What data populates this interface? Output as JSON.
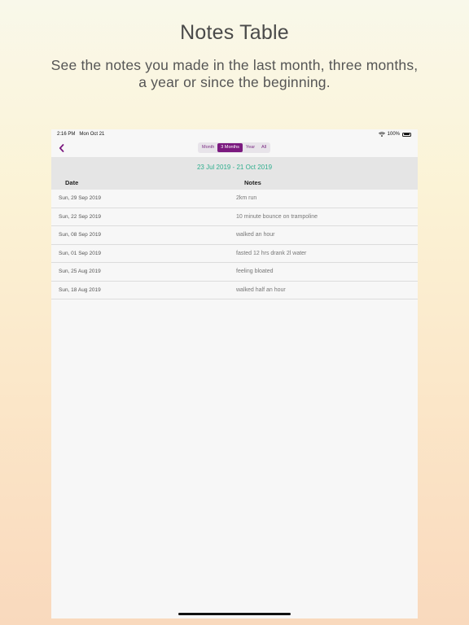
{
  "promo": {
    "title": "Notes Table",
    "subtitle": "See the notes you made in the last month, three months, a year or since the beginning."
  },
  "status_bar": {
    "time": "2:16 PM",
    "date": "Mon Oct 21",
    "battery": "100%",
    "icons": [
      "wifi-icon",
      "battery-icon"
    ]
  },
  "nav": {
    "back_icon": "chevron-left-icon",
    "segments": [
      "Month",
      "3 Months",
      "Year",
      "All"
    ],
    "selected_segment": "3 Months"
  },
  "table": {
    "date_range": "23 Jul 2019 - 21 Oct 2019",
    "columns": [
      "Date",
      "Notes"
    ],
    "rows": [
      {
        "date": "Sun, 29 Sep 2019",
        "note": "2km run"
      },
      {
        "date": "Sun, 22 Sep 2019",
        "note": "10 minute bounce on trampoline"
      },
      {
        "date": "Sun, 08 Sep 2019",
        "note": "walked an hour"
      },
      {
        "date": "Sun, 01 Sep 2019",
        "note": "fasted 12 hrs drank 2l water"
      },
      {
        "date": "Sun, 25 Aug 2019",
        "note": "feeling bloated"
      },
      {
        "date": "Sun, 18 Aug 2019",
        "note": "walked half an hour"
      }
    ]
  },
  "colors": {
    "accent": "#7b1a7f",
    "range_text": "#2fae8e"
  }
}
